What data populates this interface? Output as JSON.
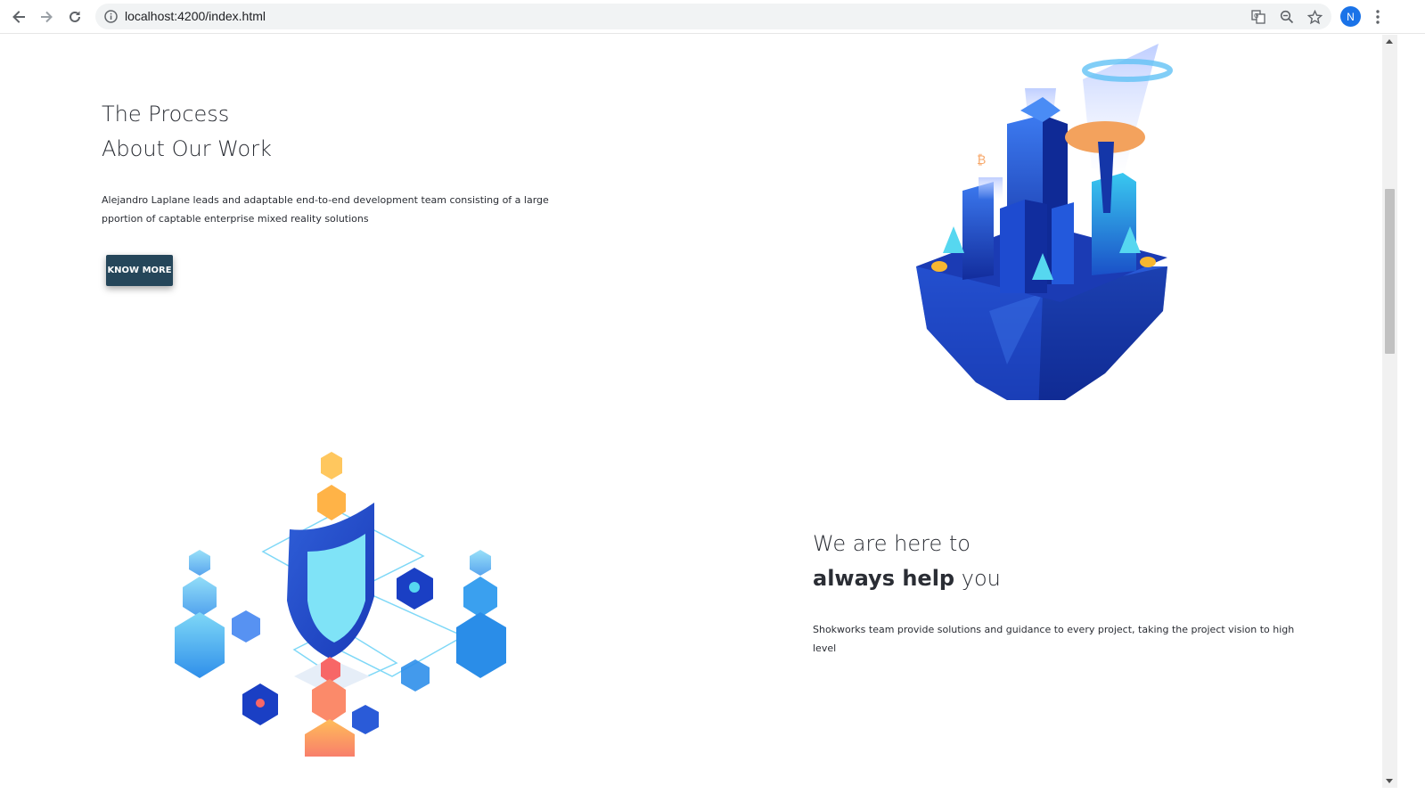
{
  "browser": {
    "url": "localhost:4200/index.html",
    "profile_initial": "N",
    "icons": [
      "back-arrow-icon",
      "forward-arrow-icon",
      "reload-icon",
      "info-icon",
      "translate-icon",
      "zoom-icon",
      "star-icon",
      "kebab-menu-icon"
    ]
  },
  "section1": {
    "title_line1": "The Process",
    "title_line2": "About Our Work",
    "description": "Alejandro Laplane leads and adaptable end-to-end development team consisting of a large pportion of captable enterprise mixed reality solutions",
    "button_label": "KNOW MORE",
    "illustration": "floating-island-city-illustration"
  },
  "section2": {
    "title_line1": "We are here to",
    "title_bold": "always help",
    "title_rest": " you",
    "description": "Shokworks team provide solutions and guidance to every project, taking the project vision to high level",
    "illustration": "blockchain-shield-illustration"
  },
  "colors": {
    "button_bg": "#25465a",
    "text": "#2a2d34",
    "accent_blue": "#1a3fc4"
  }
}
